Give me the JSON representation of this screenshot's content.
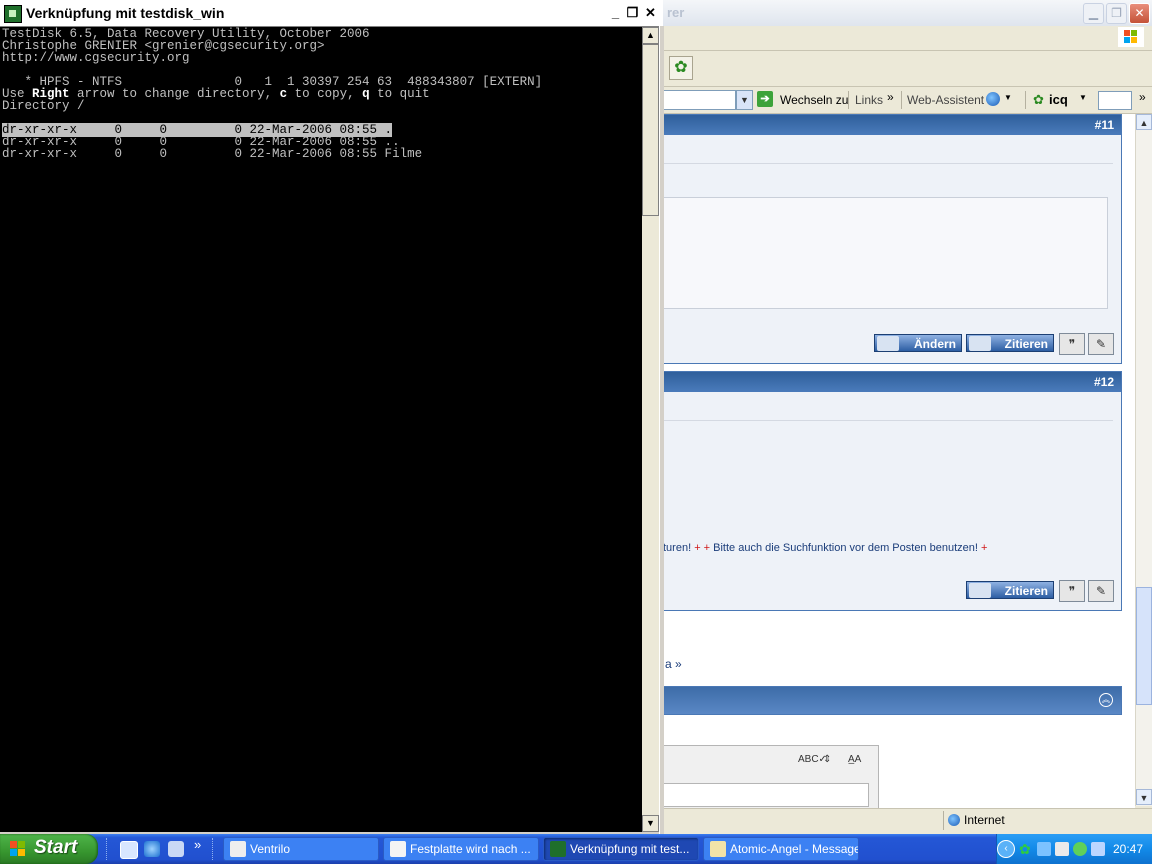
{
  "ie": {
    "title_partial": "rer",
    "address_go_label": "Wechseln zu",
    "links_label": "Links",
    "links_chevron": "»",
    "web_assistant_label": "Web-Assistent",
    "icq_label": "icq",
    "toolbar_chevron": "»",
    "post11_number": "#11",
    "post12_number": "#12",
    "edit_button": "Ändern",
    "quote_button": "Zitieren",
    "rules_text_a": "turen! ",
    "rules_text_plus1": "+ +",
    "rules_text_b": " Bitte auch die Suchfunktion vor dem Posten benutzen! ",
    "rules_text_plus2": "+",
    "nav_link_text": "a »",
    "status_zone": "Internet",
    "colors": {
      "header_blue": "#2f5f9b",
      "link_blue": "#1b3d7a",
      "plus_red": "#d01818"
    }
  },
  "console": {
    "title": "Verknüpfung mit testdisk_win",
    "min_icon": "minimize-icon",
    "restore_icon": "restore-icon",
    "close_icon": "close-icon",
    "lines": {
      "l1": "TestDisk 6.5, Data Recovery Utility, October 2006",
      "l2": "Christophe GRENIER <grenier@cgsecurity.org>",
      "l3": "http://www.cgsecurity.org",
      "l4": "   * HPFS - NTFS               0   1  1 30397 254 63  488343807 [EXTERN]",
      "l5_a": "Use ",
      "l5_b": "Right",
      "l5_c": " arrow to change directory, ",
      "l5_d": "c",
      "l5_e": " to copy, ",
      "l5_f": "q",
      "l5_g": " to quit",
      "l6": "Directory /"
    },
    "entries": [
      "dr-xr-xr-x     0     0         0 22-Mar-2006 08:55 .",
      "dr-xr-xr-x     0     0         0 22-Mar-2006 08:55 ..",
      "dr-xr-xr-x     0     0         0 22-Mar-2006 08:55 Filme"
    ]
  },
  "taskbar": {
    "start_label": "Start",
    "quicklaunch_chevron": "»",
    "buttons": [
      {
        "label": "Ventrilo"
      },
      {
        "label": "Festplatte wird nach ..."
      },
      {
        "label": "Verknüpfung mit test..."
      },
      {
        "label": "Atomic-Angel - Message"
      }
    ],
    "active_index": 2,
    "clock": "20:47"
  }
}
